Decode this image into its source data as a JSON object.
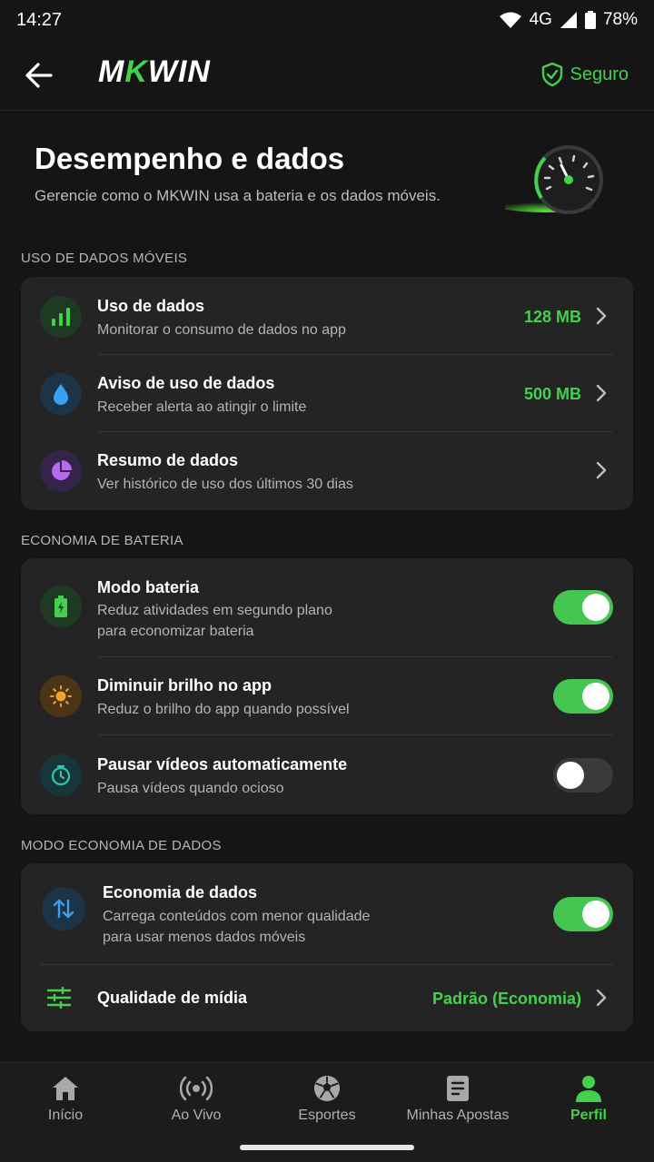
{
  "status_bar": {
    "time": "14:27",
    "network": "4G",
    "battery": "78%"
  },
  "header": {
    "brand_pre": "M",
    "brand_k": "K",
    "brand_post": "WIN",
    "secure_label": "Seguro"
  },
  "hero": {
    "title": "Desempenho e dados",
    "subtitle": "Gerencie como o MKWIN usa a bateria e os dados móveis."
  },
  "sections": {
    "mobile_data": {
      "title": "USO DE DADOS MÓVEIS",
      "rows": [
        {
          "title": "Uso de dados",
          "subtitle": "Monitorar o consumo de dados no app",
          "value": "128 MB",
          "icon": "bar-chart-icon"
        },
        {
          "title": "Aviso de uso de dados",
          "subtitle": "Receber alerta ao atingir o limite",
          "value": "500 MB",
          "icon": "drop-icon"
        },
        {
          "title": "Resumo de dados",
          "subtitle": "Ver histórico de uso dos últimos 30 dias",
          "value": "",
          "icon": "pie-chart-icon"
        }
      ]
    },
    "battery": {
      "title": "ECONOMIA DE BATERIA",
      "rows": [
        {
          "title": "Modo bateria",
          "subtitle1": "Reduz atividades em segundo plano",
          "subtitle2": "para economizar bateria",
          "enabled": true,
          "icon": "battery-icon"
        },
        {
          "title": "Diminuir brilho no app",
          "subtitle1": "Reduz o brilho do app quando possível",
          "enabled": true,
          "icon": "sun-icon"
        },
        {
          "title": "Pausar vídeos automaticamente",
          "subtitle1": "Pausa vídeos quando ocioso",
          "enabled": false,
          "icon": "timer-icon"
        }
      ]
    },
    "data_saver": {
      "title": "MODO ECONOMIA DE DADOS",
      "rows": [
        {
          "title": "Economia de dados",
          "subtitle1": "Carrega conteúdos com menor qualidade",
          "subtitle2": "para usar menos dados móveis",
          "enabled": true,
          "icon": "arrows-updown-icon"
        },
        {
          "title": "Qualidade de mídia",
          "value": "Padrão (Economia)",
          "icon": "sliders-icon"
        }
      ]
    }
  },
  "bottom_nav": [
    {
      "label": "Início",
      "icon": "home-icon",
      "active": false
    },
    {
      "label": "Ao Vivo",
      "icon": "live-icon",
      "active": false
    },
    {
      "label": "Esportes",
      "icon": "soccer-ball-icon",
      "active": false
    },
    {
      "label": "Minhas Apostas",
      "icon": "bets-icon",
      "active": false
    },
    {
      "label": "Perfil",
      "icon": "profile-icon",
      "active": true
    }
  ],
  "colors": {
    "accent": "#43d14d",
    "background": "#151515",
    "card": "#242424"
  }
}
